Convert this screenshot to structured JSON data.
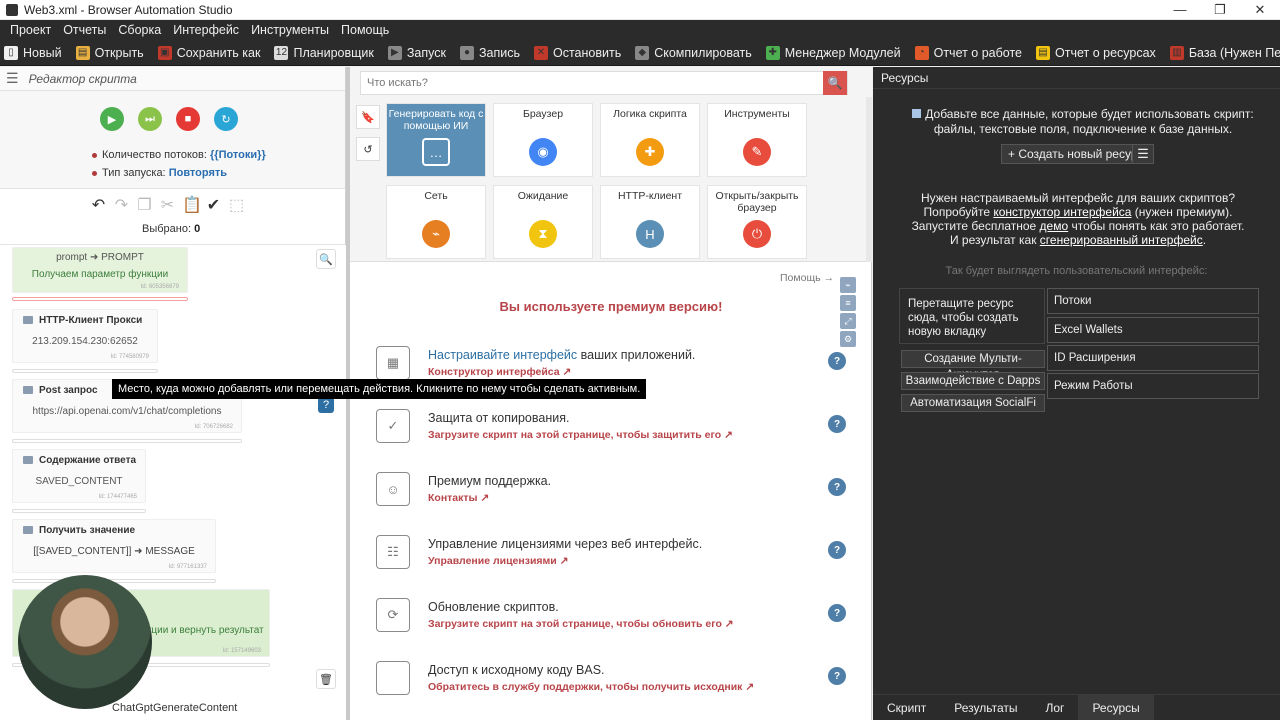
{
  "window": {
    "title": "Web3.xml - Browser Automation Studio"
  },
  "menu": [
    "Проект",
    "Отчеты",
    "Сборка",
    "Интерфейс",
    "Инструменты",
    "Помощь"
  ],
  "toolbar": [
    {
      "label": "Новый",
      "icon": "new-file-icon",
      "color": "#f0f0f0"
    },
    {
      "label": "Открыть",
      "icon": "folder-icon",
      "color": "#e8b040"
    },
    {
      "label": "Сохранить как",
      "icon": "save-icon",
      "color": "#c0392b"
    },
    {
      "label": "Планировщик",
      "icon": "calendar-icon",
      "color": "#dddddd"
    },
    {
      "label": "Запуск",
      "icon": "play-icon",
      "color": "#888888"
    },
    {
      "label": "Запись",
      "icon": "record-icon",
      "color": "#888888"
    },
    {
      "label": "Остановить",
      "icon": "stop-icon",
      "color": "#c0392b"
    },
    {
      "label": "Скомпилировать",
      "icon": "box-icon",
      "color": "#888888"
    },
    {
      "label": "Менеджер Модулей",
      "icon": "puzzle-icon",
      "color": "#4caf50"
    },
    {
      "label": "Отчет о работе",
      "icon": "pie-chart-icon",
      "color": "#e25a2a"
    },
    {
      "label": "Отчет о ресурсах",
      "icon": "document-icon",
      "color": "#f1c40f"
    },
    {
      "label": "База (Нужен Перезапуск)",
      "icon": "database-icon",
      "color": "#c0392b"
    }
  ],
  "left": {
    "header": "Редактор скрипта",
    "threads_label": "Количество потоков:",
    "threads_value": "{{Потоки}}",
    "run_type_label": "Тип запуска:",
    "run_type_value": "Повторять",
    "selected_label": "Выбрано:",
    "selected_value": "0",
    "footer": "ChatGptGenerateContent",
    "tooltip": "Место, куда можно добавлять или перемещать действия. Кликните по нему чтобы сделать активным.",
    "blocks": [
      {
        "title": "",
        "line1": "prompt ➜ PROMPT",
        "line2": "Получаем параметр функции",
        "id": "Id: 605356879"
      },
      {
        "title": "HTTP-Клиент Прокси",
        "value": "213.209.154.230:62652",
        "id": "Id: 774580979"
      },
      {
        "title": "Post запрос",
        "value": "https://api.openai.com/v1/chat/completions",
        "id": "Id: 706726682"
      },
      {
        "title": "Содержание ответа",
        "value": "SAVED_CONTENT",
        "id": "Id: 174477465"
      },
      {
        "title": "Получить значение",
        "value": "[[SAVED_CONTENT]] ➜ MESSAGE",
        "id": "Id: 977161337"
      },
      {
        "title": "",
        "line1": "value",
        "line2": "кции и вернуть результат",
        "id": "Id: 157149603"
      }
    ]
  },
  "mid": {
    "search_placeholder": "Что искать?",
    "tiles": [
      {
        "label": "Генерировать код с помощью ИИ",
        "icon": "chat-icon",
        "color": "#5b8fb5"
      },
      {
        "label": "Браузер",
        "icon": "chrome-icon",
        "color": "#4285f4"
      },
      {
        "label": "Логика скрипта",
        "icon": "puzzle-icon",
        "color": "#f39c12"
      },
      {
        "label": "Инструменты",
        "icon": "wrench-icon",
        "color": "#e74c3c"
      },
      {
        "label": "Сеть",
        "icon": "antenna-icon",
        "color": "#e67e22"
      },
      {
        "label": "Ожидание",
        "icon": "hourglass-icon",
        "color": "#f1c40f"
      },
      {
        "label": "HTTP-клиент",
        "icon": "http-icon",
        "color": "#5b8fb5"
      },
      {
        "label": "Открыть/закрыть браузер",
        "icon": "power-icon",
        "color": "#e74c3c"
      }
    ],
    "help_link": "Помощь →",
    "premium_title": "Вы используете премиум версию!",
    "features": [
      {
        "title_hl": "Настраивайте интерфейс",
        "title_rest": " ваших приложений.",
        "link": "Конструктор интерфейса",
        "icon": "interface-icon"
      },
      {
        "title_hl": "",
        "title_rest": "Защита от копирования.",
        "link": "Загрузите скрипт на этой странице, чтобы защитить его",
        "icon": "shield-icon"
      },
      {
        "title_hl": "",
        "title_rest": "Премиум поддержка.",
        "link": "Контакты",
        "icon": "support-icon"
      },
      {
        "title_hl": "",
        "title_rest": "Управление лицензиями через веб интерфейс.",
        "link": "Управление лицензиями",
        "icon": "users-icon"
      },
      {
        "title_hl": "",
        "title_rest": "Обновление скриптов.",
        "link": "Загрузите скрипт на этой странице, чтобы обновить его",
        "icon": "update-icon"
      },
      {
        "title_hl": "",
        "title_rest": "Доступ к исходному коду BAS.",
        "link": "Обратитесь в службу поддержки, чтобы получить исходник",
        "icon": "code-icon"
      }
    ]
  },
  "right": {
    "header": "Ресурсы",
    "info": "Добавьте все данные, которые будет использовать скрипт: файлы, текстовые поля, подключение к базе данных.",
    "create_btn": "+ Создать новый ресурс",
    "text_l1": "Нужен настраиваемый интерфейс для ваших скриптов?",
    "text_l2a": "Попробуйте ",
    "text_l2u": "конструктор интерфейса",
    "text_l2b": " (нужен премиум).",
    "text_l3a": "Запустите бесплатное ",
    "text_l3u": "демо",
    "text_l3b": " чтобы понять как это работает.",
    "text_l4a": "И результат как ",
    "text_l4u": "сгенерированный интерфейс",
    "text_l4b": ".",
    "preview_label": "Так будет выглядеть пользовательский интерфейс:",
    "drop_zone": "Перетащите ресурс сюда, чтобы создать новую вкладку",
    "buttons": [
      "Создание Мульти-Аккаунтов",
      "Взаимодействие с Dapps",
      "Автоматизация SocialFi"
    ],
    "items": [
      "Потоки",
      "Excel Wallets",
      "ID Расширения",
      "Режим Работы"
    ],
    "tabs": [
      "Скрипт",
      "Результаты",
      "Лог",
      "Ресурсы"
    ]
  }
}
